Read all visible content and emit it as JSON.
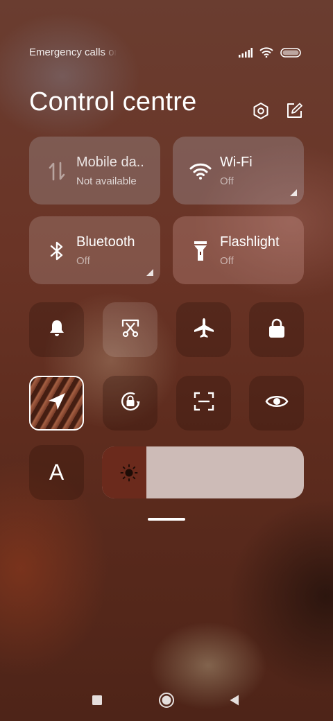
{
  "status_bar": {
    "carrier_text": "Emergency calls only",
    "icons": [
      "signal-icon",
      "wifi-icon",
      "battery-icon"
    ]
  },
  "header": {
    "title": "Control centre",
    "icons": [
      "settings-icon",
      "edit-icon"
    ]
  },
  "big_tiles": [
    {
      "name": "mobile-data",
      "title": "Mobile da..",
      "status": "Not available",
      "icon": "mobile-data-icon"
    },
    {
      "name": "wifi",
      "title": "Wi-Fi",
      "status": "Off",
      "icon": "wifi-icon"
    },
    {
      "name": "bluetooth",
      "title": "Bluetooth",
      "status": "Off",
      "icon": "bluetooth-icon"
    },
    {
      "name": "flashlight",
      "title": "Flashlight",
      "status": "Off",
      "icon": "flashlight-icon"
    }
  ],
  "toggles_row1": [
    "bell-icon",
    "screenshot-icon",
    "airplane-icon",
    "lock-icon"
  ],
  "toggles_row2": [
    "location-icon",
    "rotation-lock-icon",
    "scan-icon",
    "eye-icon"
  ],
  "font_tile": {
    "label": "A"
  },
  "brightness": {
    "level": 0.22,
    "icon": "sun-icon"
  },
  "nav": [
    "recents-icon",
    "home-icon",
    "back-icon"
  ],
  "colors": {
    "background": "#6a3426",
    "brightness_fill": "#6b2a1c",
    "brightness_track": "#d7c8c4"
  }
}
